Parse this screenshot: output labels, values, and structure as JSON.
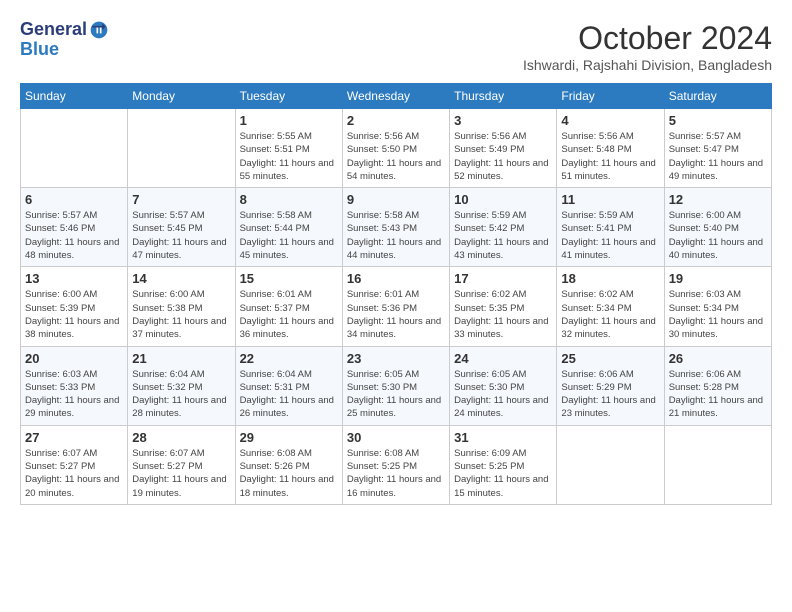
{
  "header": {
    "logo_line1": "General",
    "logo_line2": "Blue",
    "month_title": "October 2024",
    "location": "Ishwardi, Rajshahi Division, Bangladesh"
  },
  "weekdays": [
    "Sunday",
    "Monday",
    "Tuesday",
    "Wednesday",
    "Thursday",
    "Friday",
    "Saturday"
  ],
  "weeks": [
    [
      {
        "day": "",
        "info": ""
      },
      {
        "day": "",
        "info": ""
      },
      {
        "day": "1",
        "info": "Sunrise: 5:55 AM\nSunset: 5:51 PM\nDaylight: 11 hours and 55 minutes."
      },
      {
        "day": "2",
        "info": "Sunrise: 5:56 AM\nSunset: 5:50 PM\nDaylight: 11 hours and 54 minutes."
      },
      {
        "day": "3",
        "info": "Sunrise: 5:56 AM\nSunset: 5:49 PM\nDaylight: 11 hours and 52 minutes."
      },
      {
        "day": "4",
        "info": "Sunrise: 5:56 AM\nSunset: 5:48 PM\nDaylight: 11 hours and 51 minutes."
      },
      {
        "day": "5",
        "info": "Sunrise: 5:57 AM\nSunset: 5:47 PM\nDaylight: 11 hours and 49 minutes."
      }
    ],
    [
      {
        "day": "6",
        "info": "Sunrise: 5:57 AM\nSunset: 5:46 PM\nDaylight: 11 hours and 48 minutes."
      },
      {
        "day": "7",
        "info": "Sunrise: 5:57 AM\nSunset: 5:45 PM\nDaylight: 11 hours and 47 minutes."
      },
      {
        "day": "8",
        "info": "Sunrise: 5:58 AM\nSunset: 5:44 PM\nDaylight: 11 hours and 45 minutes."
      },
      {
        "day": "9",
        "info": "Sunrise: 5:58 AM\nSunset: 5:43 PM\nDaylight: 11 hours and 44 minutes."
      },
      {
        "day": "10",
        "info": "Sunrise: 5:59 AM\nSunset: 5:42 PM\nDaylight: 11 hours and 43 minutes."
      },
      {
        "day": "11",
        "info": "Sunrise: 5:59 AM\nSunset: 5:41 PM\nDaylight: 11 hours and 41 minutes."
      },
      {
        "day": "12",
        "info": "Sunrise: 6:00 AM\nSunset: 5:40 PM\nDaylight: 11 hours and 40 minutes."
      }
    ],
    [
      {
        "day": "13",
        "info": "Sunrise: 6:00 AM\nSunset: 5:39 PM\nDaylight: 11 hours and 38 minutes."
      },
      {
        "day": "14",
        "info": "Sunrise: 6:00 AM\nSunset: 5:38 PM\nDaylight: 11 hours and 37 minutes."
      },
      {
        "day": "15",
        "info": "Sunrise: 6:01 AM\nSunset: 5:37 PM\nDaylight: 11 hours and 36 minutes."
      },
      {
        "day": "16",
        "info": "Sunrise: 6:01 AM\nSunset: 5:36 PM\nDaylight: 11 hours and 34 minutes."
      },
      {
        "day": "17",
        "info": "Sunrise: 6:02 AM\nSunset: 5:35 PM\nDaylight: 11 hours and 33 minutes."
      },
      {
        "day": "18",
        "info": "Sunrise: 6:02 AM\nSunset: 5:34 PM\nDaylight: 11 hours and 32 minutes."
      },
      {
        "day": "19",
        "info": "Sunrise: 6:03 AM\nSunset: 5:34 PM\nDaylight: 11 hours and 30 minutes."
      }
    ],
    [
      {
        "day": "20",
        "info": "Sunrise: 6:03 AM\nSunset: 5:33 PM\nDaylight: 11 hours and 29 minutes."
      },
      {
        "day": "21",
        "info": "Sunrise: 6:04 AM\nSunset: 5:32 PM\nDaylight: 11 hours and 28 minutes."
      },
      {
        "day": "22",
        "info": "Sunrise: 6:04 AM\nSunset: 5:31 PM\nDaylight: 11 hours and 26 minutes."
      },
      {
        "day": "23",
        "info": "Sunrise: 6:05 AM\nSunset: 5:30 PM\nDaylight: 11 hours and 25 minutes."
      },
      {
        "day": "24",
        "info": "Sunrise: 6:05 AM\nSunset: 5:30 PM\nDaylight: 11 hours and 24 minutes."
      },
      {
        "day": "25",
        "info": "Sunrise: 6:06 AM\nSunset: 5:29 PM\nDaylight: 11 hours and 23 minutes."
      },
      {
        "day": "26",
        "info": "Sunrise: 6:06 AM\nSunset: 5:28 PM\nDaylight: 11 hours and 21 minutes."
      }
    ],
    [
      {
        "day": "27",
        "info": "Sunrise: 6:07 AM\nSunset: 5:27 PM\nDaylight: 11 hours and 20 minutes."
      },
      {
        "day": "28",
        "info": "Sunrise: 6:07 AM\nSunset: 5:27 PM\nDaylight: 11 hours and 19 minutes."
      },
      {
        "day": "29",
        "info": "Sunrise: 6:08 AM\nSunset: 5:26 PM\nDaylight: 11 hours and 18 minutes."
      },
      {
        "day": "30",
        "info": "Sunrise: 6:08 AM\nSunset: 5:25 PM\nDaylight: 11 hours and 16 minutes."
      },
      {
        "day": "31",
        "info": "Sunrise: 6:09 AM\nSunset: 5:25 PM\nDaylight: 11 hours and 15 minutes."
      },
      {
        "day": "",
        "info": ""
      },
      {
        "day": "",
        "info": ""
      }
    ]
  ]
}
